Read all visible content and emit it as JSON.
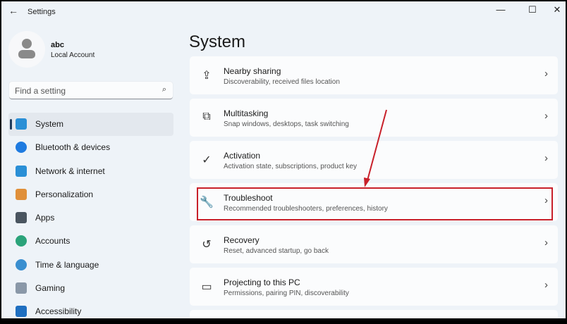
{
  "window": {
    "title": "Settings",
    "back": "←",
    "min": "—",
    "max": "☐",
    "close": "✕"
  },
  "user": {
    "name": "abc",
    "type": "Local Account"
  },
  "search": {
    "placeholder": "Find a setting",
    "icon": "⌕"
  },
  "nav": [
    {
      "label": "System",
      "color": "#2a8fd6"
    },
    {
      "label": "Bluetooth & devices",
      "color": "#1f7be0"
    },
    {
      "label": "Network & internet",
      "color": "#2a8fd6"
    },
    {
      "label": "Personalization",
      "color": "#e0903a"
    },
    {
      "label": "Apps",
      "color": "#4a5560"
    },
    {
      "label": "Accounts",
      "color": "#2ba37a"
    },
    {
      "label": "Time & language",
      "color": "#3a8fd0"
    },
    {
      "label": "Gaming",
      "color": "#8a98a8"
    },
    {
      "label": "Accessibility",
      "color": "#1f6fc0"
    }
  ],
  "page_title": "System",
  "cards": [
    {
      "icon": "⇪",
      "title": "Nearby sharing",
      "sub": "Discoverability, received files location"
    },
    {
      "icon": "⧉",
      "title": "Multitasking",
      "sub": "Snap windows, desktops, task switching"
    },
    {
      "icon": "✓",
      "title": "Activation",
      "sub": "Activation state, subscriptions, product key"
    },
    {
      "icon": "🔧",
      "title": "Troubleshoot",
      "sub": "Recommended troubleshooters, preferences, history"
    },
    {
      "icon": "↺",
      "title": "Recovery",
      "sub": "Reset, advanced startup, go back"
    },
    {
      "icon": "▭",
      "title": "Projecting to this PC",
      "sub": "Permissions, pairing PIN, discoverability"
    }
  ],
  "chevron": "›",
  "highlight_color": "#c8202a"
}
